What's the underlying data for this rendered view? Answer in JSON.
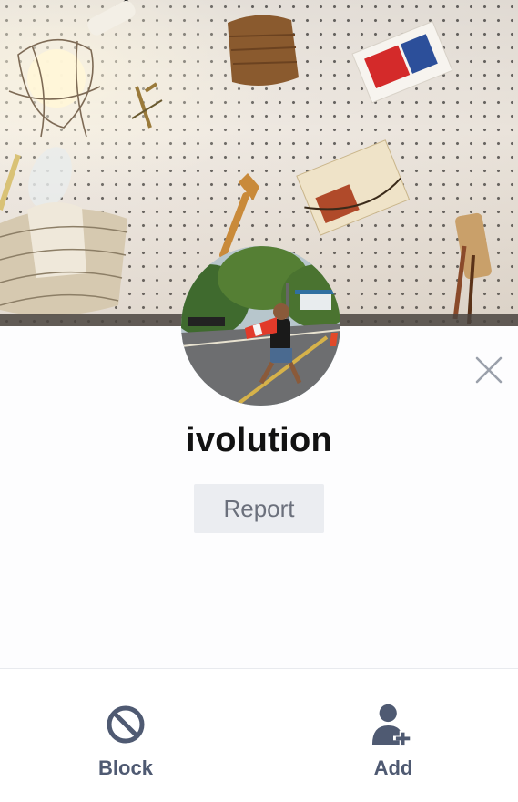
{
  "profile": {
    "name": "ivolution",
    "report_label": "Report"
  },
  "actions": {
    "block_label": "Block",
    "add_label": "Add"
  },
  "icons": {
    "close": "close-icon",
    "block": "block-icon",
    "add": "add-friend-icon"
  },
  "colors": {
    "name_text": "#121212",
    "report_bg": "#ebedf1",
    "report_text": "#6b707c",
    "action_icon": "#4f5a72",
    "close_icon": "#9aa0aa"
  }
}
